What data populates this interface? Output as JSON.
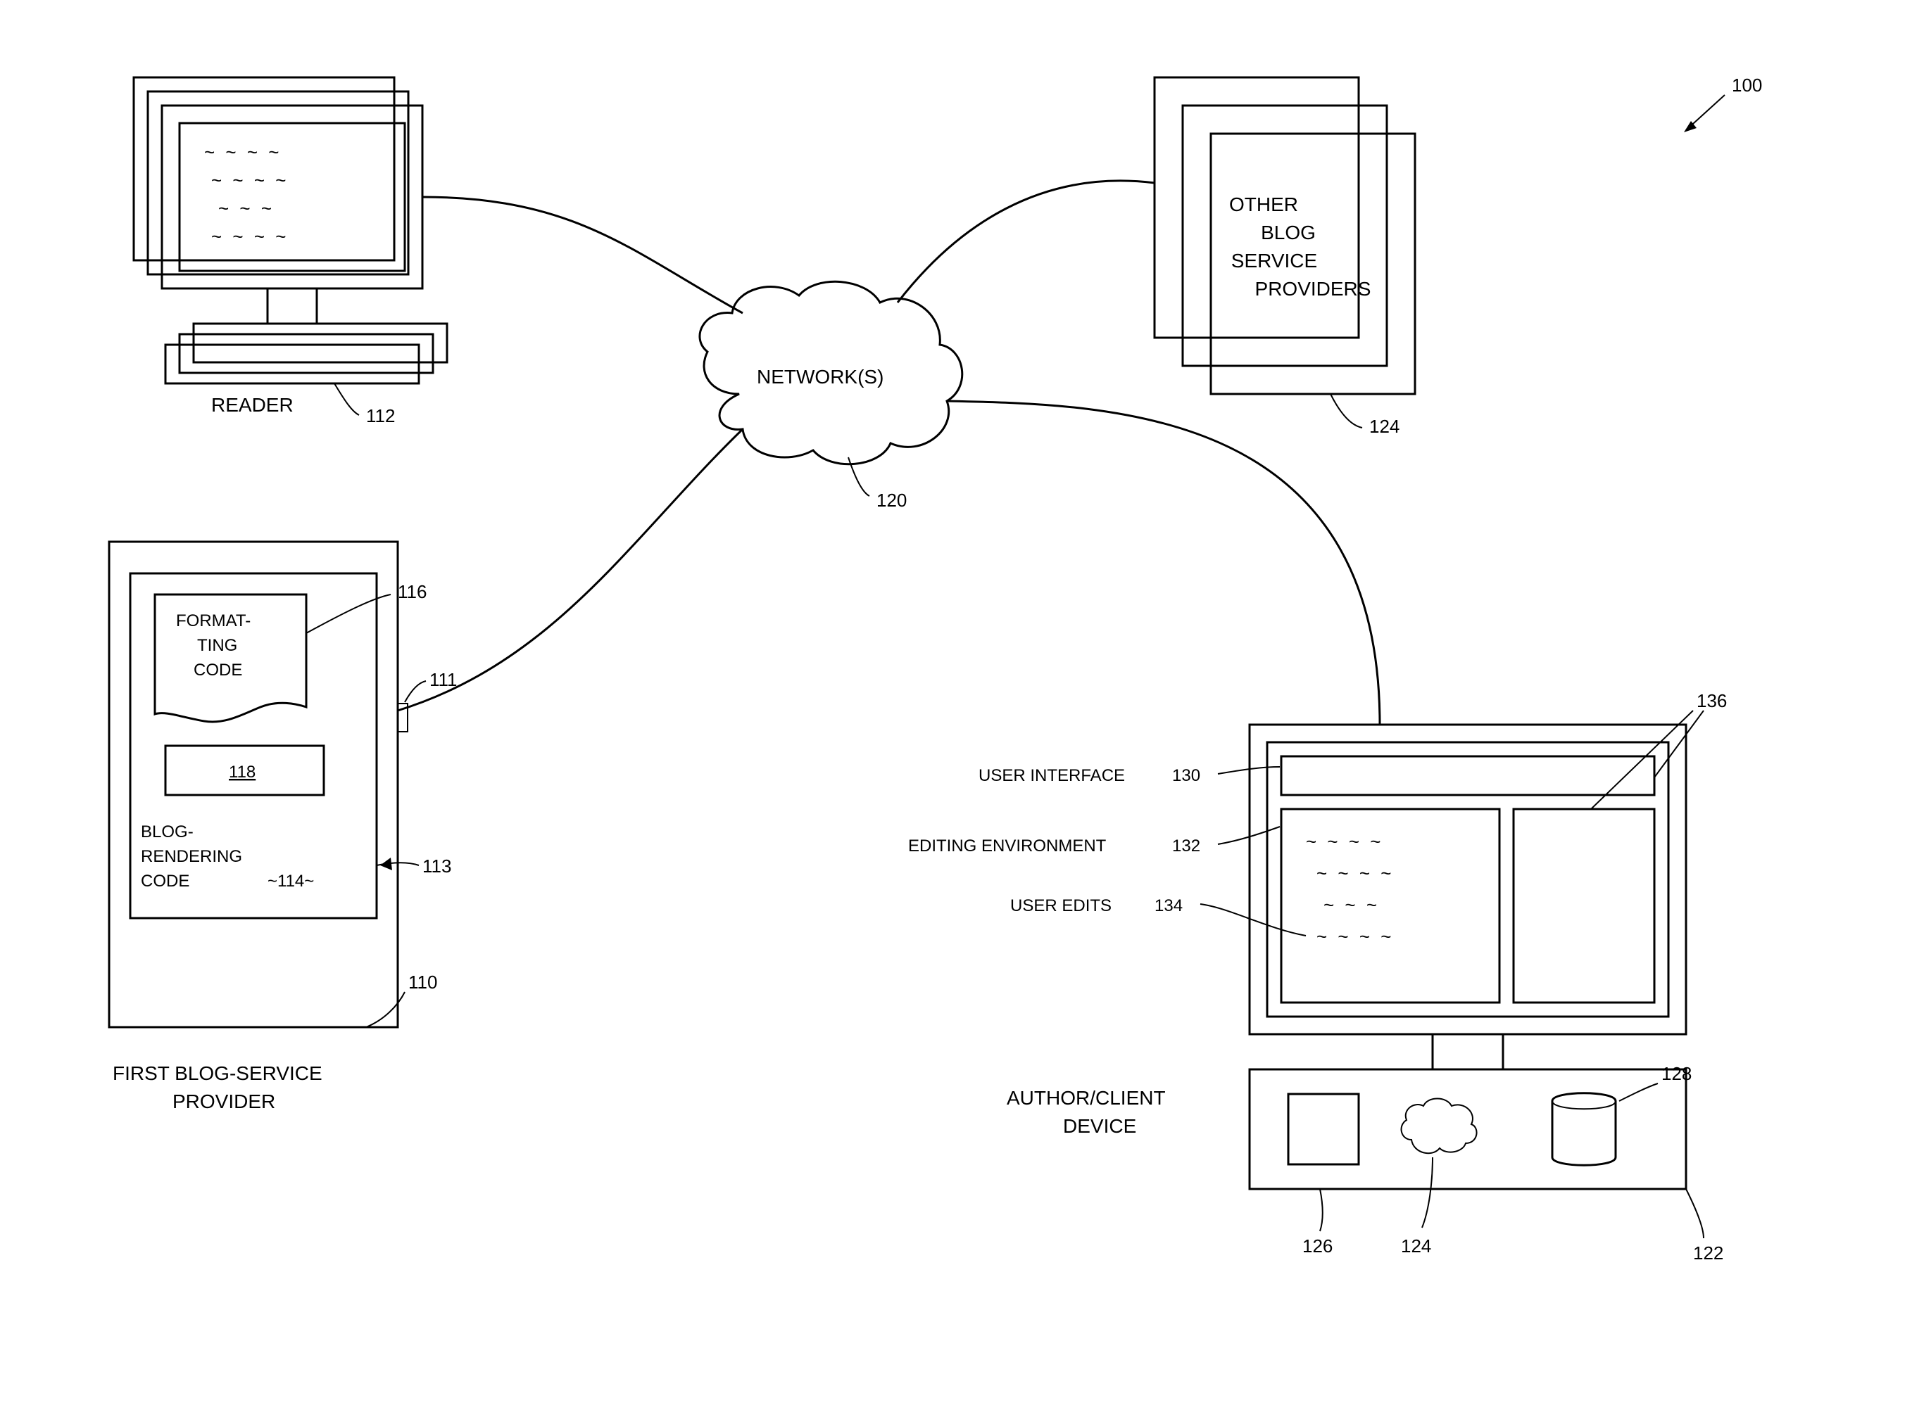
{
  "figure_ref": "100",
  "reader": {
    "label": "READER",
    "ref": "112"
  },
  "network": {
    "label": "NETWORK(S)",
    "ref": "120"
  },
  "other_providers": {
    "line1": "OTHER",
    "line2": "BLOG",
    "line3": "SERVICE",
    "line4": "PROVIDERS",
    "ref": "124"
  },
  "first_provider": {
    "label_line1": "FIRST BLOG-SERVICE",
    "label_line2": "PROVIDER",
    "ref": "110",
    "blog_rendering_line1": "BLOG-",
    "blog_rendering_line2": "RENDERING",
    "blog_rendering_line3": "CODE",
    "blog_rendering_inner": "~114~",
    "blog_rendering_ref": "113",
    "formatting_line1": "FORMAT-",
    "formatting_line2": "TING",
    "formatting_line3": "CODE",
    "formatting_ref": "116",
    "inner_box": "118",
    "port_ref": "111"
  },
  "author": {
    "label_line1": "AUTHOR/CLIENT",
    "label_line2": "DEVICE",
    "ref_device": "122",
    "ref_square": "126",
    "ref_cloud": "124",
    "ref_cyl": "128",
    "ui_label": "USER INTERFACE",
    "ui_ref": "130",
    "editing_label": "EDITING ENVIRONMENT",
    "editing_ref": "132",
    "edits_label": "USER EDITS",
    "edits_ref": "134",
    "panels_ref": "136"
  }
}
